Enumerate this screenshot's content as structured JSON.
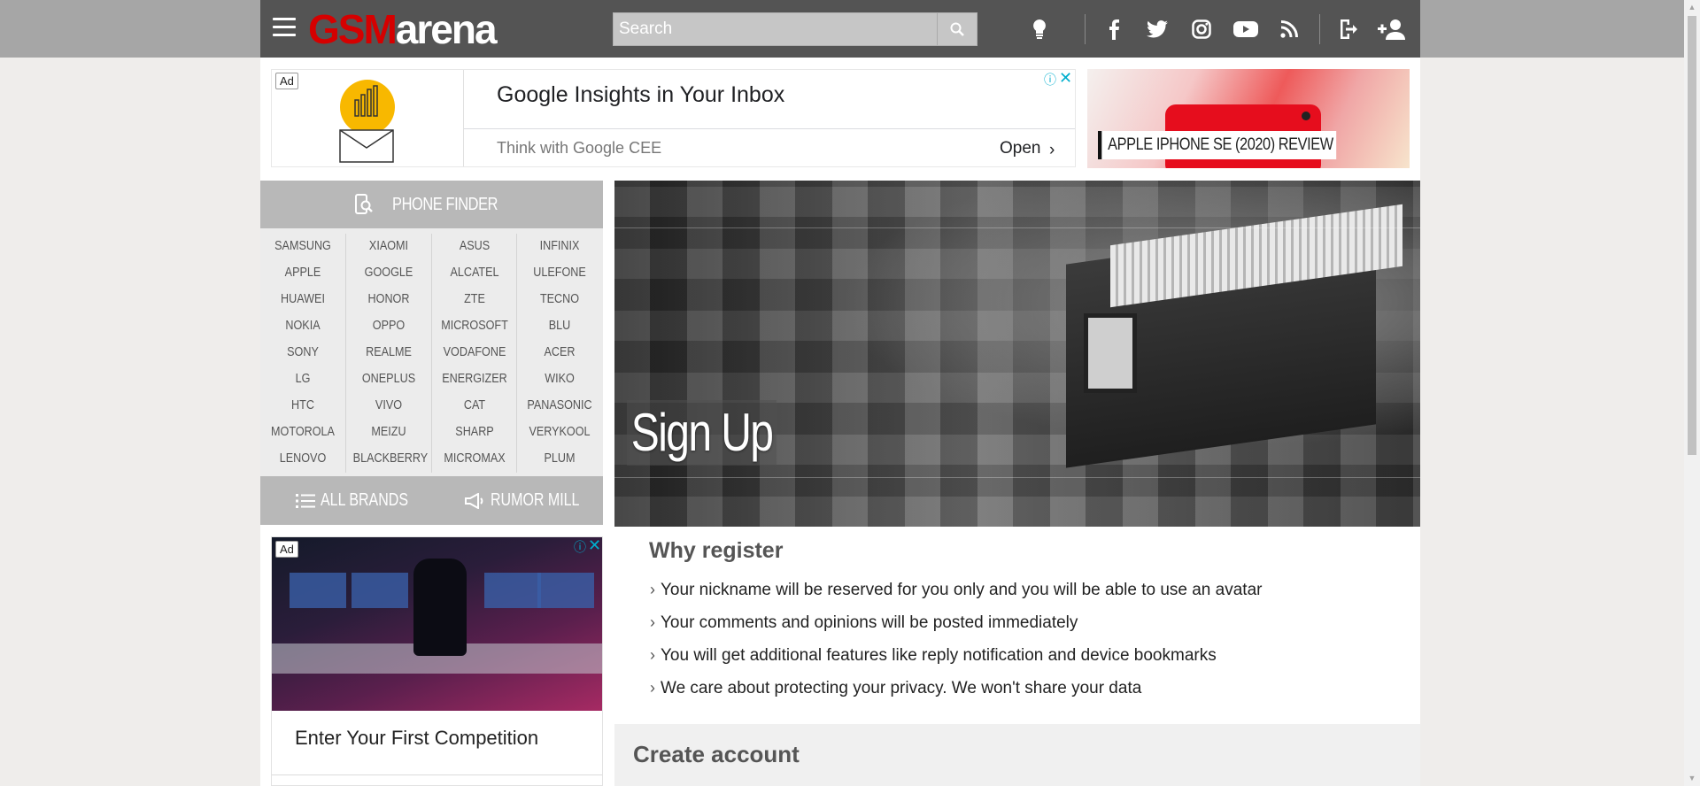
{
  "header": {
    "logo_gsm": "GSM",
    "logo_arena": "arena",
    "search_placeholder": "Search"
  },
  "ad_top": {
    "badge": "Ad",
    "title": "Google Insights in Your Inbox",
    "subtitle": "Think with Google CEE",
    "cta": "Open"
  },
  "promo": {
    "label": "APPLE IPHONE SE (2020) REVIEW"
  },
  "phone_finder": {
    "title": "PHONE FINDER",
    "brand_columns": [
      [
        "SAMSUNG",
        "APPLE",
        "HUAWEI",
        "NOKIA",
        "SONY",
        "LG",
        "HTC",
        "MOTOROLA",
        "LENOVO"
      ],
      [
        "XIAOMI",
        "GOOGLE",
        "HONOR",
        "OPPO",
        "REALME",
        "ONEPLUS",
        "VIVO",
        "MEIZU",
        "BLACKBERRY"
      ],
      [
        "ASUS",
        "ALCATEL",
        "ZTE",
        "MICROSOFT",
        "VODAFONE",
        "ENERGIZER",
        "CAT",
        "SHARP",
        "MICROMAX"
      ],
      [
        "INFINIX",
        "ULEFONE",
        "TECNO",
        "BLU",
        "ACER",
        "WIKO",
        "PANASONIC",
        "VERYKOOL",
        "PLUM"
      ]
    ],
    "all_brands": "ALL BRANDS",
    "rumor_mill": "RUMOR MILL"
  },
  "ad_side": {
    "badge": "Ad",
    "caption": "Enter Your First Competition"
  },
  "hero": {
    "title": "Sign Up"
  },
  "why": {
    "heading": "Why register",
    "reasons": [
      "Your nickname will be reserved for you only and you will be able to use an avatar",
      "Your comments and opinions will be posted immediately",
      "You will get additional features like reply notification and device bookmarks",
      "We care about protecting your privacy. We won't share your data"
    ]
  },
  "create": {
    "heading": "Create account"
  },
  "colors": {
    "header_bg": "#545454",
    "logo_red": "#d50000",
    "sidebar_grey": "#b8b8b8",
    "ad_info_blue": "#00aecd"
  },
  "icons": [
    "menu-icon",
    "search-icon",
    "lightbulb-icon",
    "facebook-icon",
    "twitter-icon",
    "instagram-icon",
    "youtube-icon",
    "rss-icon",
    "login-icon",
    "add-user-icon",
    "phone-finder-icon",
    "list-icon",
    "megaphone-icon",
    "ad-info-icon",
    "ad-close-icon",
    "chevron-right-icon"
  ]
}
